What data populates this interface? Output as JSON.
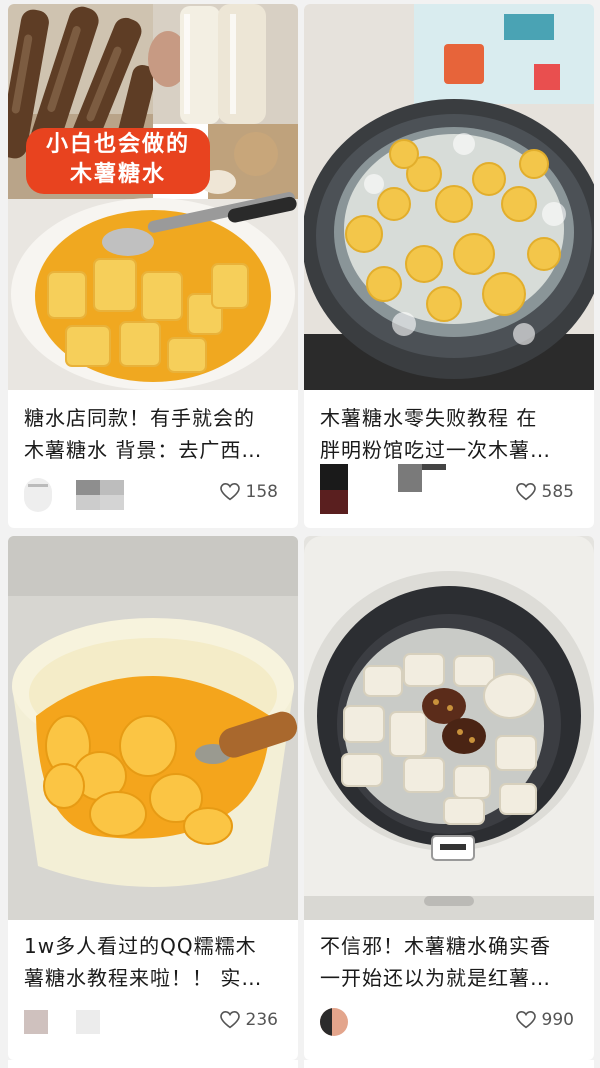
{
  "cards": [
    {
      "title_line1": "糖水店同款！有手就会的",
      "title_line2": "木薯糖水 背景：去广西…",
      "likes": "158",
      "overlay_line1": "小白也会做的",
      "overlay_line2": "木薯糖水"
    },
    {
      "title_line1": "木薯糖水零失败教程 在",
      "title_line2": "胖明粉馆吃过一次木薯…",
      "likes": "585"
    },
    {
      "title_line1": "1w多人看过的QQ糯糯木",
      "title_line2": "薯糖水教程来啦！！ 实…",
      "likes": "236"
    },
    {
      "title_line1": "不信邪！木薯糖水确实香",
      "title_line2": "一开始还以为就是红薯…",
      "likes": "990"
    }
  ],
  "colors": {
    "background": "#f2f2f2",
    "card": "#ffffff",
    "overlay_label": "#e8431f",
    "syrup": "#f0a820"
  }
}
